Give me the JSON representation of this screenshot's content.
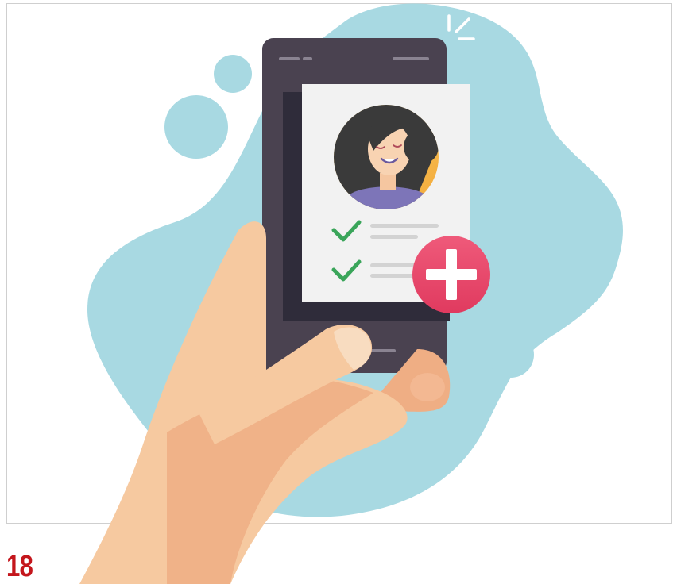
{
  "page_number": "18",
  "colors": {
    "blob": "#a8d9e2",
    "phone_body": "#4a4250",
    "phone_screen": "#2f2c3a",
    "card": "#f2f2f2",
    "check": "#3aa55a",
    "plus_badge": "#e8476b",
    "skin": "#f6c9a0",
    "skin_shadow": "#efae84",
    "page_number": "#c4161c"
  },
  "icons": [
    "check-icon",
    "plus-icon",
    "avatar"
  ]
}
